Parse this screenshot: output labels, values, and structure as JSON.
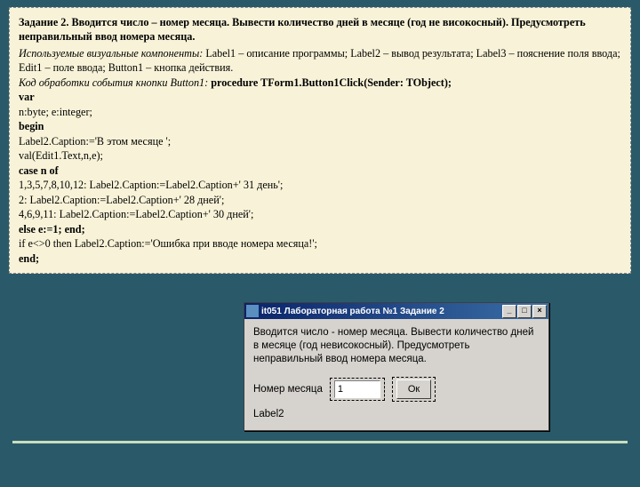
{
  "task": {
    "title_prefix": "Задание 2.",
    "title_rest": " Вводится число – номер месяца. Вывести количество дней в месяце (год не високосный). Предусмотреть неправильный ввод номера месяца.",
    "components_prefix": "Используемые визуальные компоненты:",
    "components_rest": " Label1 – описание программы; Label2 – вывод результата; Label3 – пояснение поля ввода; Edit1 – поле ввода; Button1 – кнопка действия.",
    "handler_prefix": "Код обработки события кнопки Button1:",
    "handler_sig": " procedure TForm1.Button1Click(Sender: TObject);"
  },
  "code": {
    "l1": "var",
    "l2": "n:byte;  e:integer;",
    "l3": "begin",
    "l4": "Label2.Caption:='В этом месяце ';",
    "l5": "val(Edit1.Text,n,e);",
    "l6": "case n of",
    "l7": "1,3,5,7,8,10,12: Label2.Caption:=Label2.Caption+' 31 день';",
    "l8": "2:              Label2.Caption:=Label2.Caption+' 28 дней';",
    "l9": "4,6,9,11:       Label2.Caption:=Label2.Caption+' 30 дней';",
    "l10": "else e:=1; end;",
    "l11": "if e<>0 then  Label2.Caption:='Ошибка при вводе номера месяца!';",
    "l12": "end;"
  },
  "window": {
    "title": "it051 Лабораторная работа №1   Задание 2",
    "min": "_",
    "max": "□",
    "close": "×",
    "description": "Вводится число - номер месяца. Вывести количество дней в месяце (год невисокосный). Предусмотреть неправильный ввод номера месяца.",
    "input_label": "Номер месяца",
    "input_value": "1",
    "button_label": "Ок",
    "result_label": "Label2"
  }
}
